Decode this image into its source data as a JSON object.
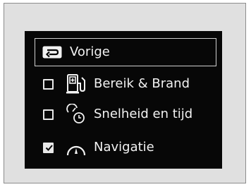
{
  "menu": {
    "back": {
      "label": "Vorige",
      "icon": "back-arrow-icon"
    },
    "items": [
      {
        "label": "Bereik & Brand",
        "icon": "fuel-pump-icon",
        "checked": false
      },
      {
        "label": "Snelheid en tijd",
        "icon": "speed-clock-icon",
        "checked": false
      },
      {
        "label": "Navigatie",
        "icon": "compass-gauge-icon",
        "checked": true
      }
    ]
  },
  "colors": {
    "screen_background": "#070707",
    "text": "#f2f2f2",
    "page_background": "#e0e0e0"
  }
}
